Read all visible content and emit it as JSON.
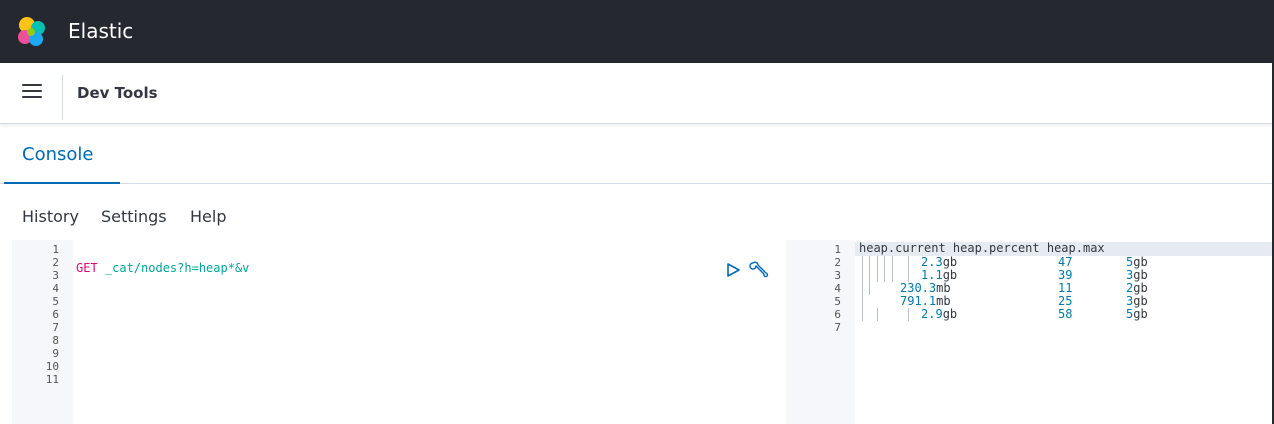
{
  "app": {
    "brand": "Elastic"
  },
  "breadcrumb": {
    "current": "Dev Tools"
  },
  "tabs": [
    {
      "label": "Console"
    }
  ],
  "menu": {
    "history": "History",
    "settings": "Settings",
    "help": "Help"
  },
  "editor": {
    "line_numbers": [
      "1",
      "2",
      "3",
      "4",
      "5",
      "6",
      "7",
      "8",
      "9",
      "10",
      "11"
    ],
    "request": {
      "method": "GET",
      "path": " _cat/nodes?h=heap*&v"
    },
    "actions": {
      "run_icon": "play-icon",
      "settings_icon": "wrench-icon"
    }
  },
  "output": {
    "line_numbers": [
      "1",
      "2",
      "3",
      "4",
      "5",
      "6",
      "7"
    ],
    "header": "heap.current heap.percent heap.max",
    "columns": [
      "heap.current",
      "heap.percent",
      "heap.max"
    ],
    "rows": [
      {
        "current_num": "2.3",
        "current_unit": "gb",
        "percent": "47",
        "max_num": "5",
        "max_unit": "gb"
      },
      {
        "current_num": "1.1",
        "current_unit": "gb",
        "percent": "39",
        "max_num": "3",
        "max_unit": "gb"
      },
      {
        "current_num": "230.3",
        "current_unit": "mb",
        "percent": "11",
        "max_num": "2",
        "max_unit": "gb"
      },
      {
        "current_num": "791.1",
        "current_unit": "mb",
        "percent": "25",
        "max_num": "3",
        "max_unit": "gb"
      },
      {
        "current_num": "2.9",
        "current_unit": "gb",
        "percent": "58",
        "max_num": "5",
        "max_unit": "gb"
      }
    ]
  },
  "colors": {
    "header_bg": "#25282f",
    "accent": "#006bb4",
    "method": "#dd0a73",
    "path": "#00a69b",
    "number": "#0079a5"
  }
}
